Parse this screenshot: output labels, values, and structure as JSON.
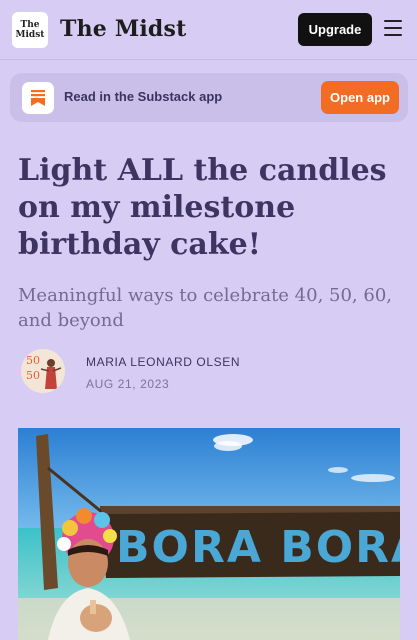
{
  "header": {
    "logo_line1": "The",
    "logo_line2": "Midst",
    "publication_name": "The Midst",
    "upgrade_label": "Upgrade",
    "menu_icon": "hamburger-menu-icon"
  },
  "app_banner": {
    "icon": "substack-bookmark-icon",
    "text": "Read in the Substack app",
    "button_label": "Open app"
  },
  "article": {
    "title": "Light ALL the candles on my milestone birthday cake!",
    "subtitle": "Meaningful ways to celebrate 40, 50, 60, and beyond",
    "author": "MARIA LEONARD OLSEN",
    "date": "AUG 21, 2023",
    "hero_sign_text": "BORA BORA",
    "avatar_text_top": "50",
    "avatar_text_bottom": "50"
  },
  "colors": {
    "background": "#d6ccf4",
    "banner": "#c9bfe9",
    "accent_orange": "#f26c24",
    "title": "#3d3461",
    "subtitle": "#736b92"
  }
}
